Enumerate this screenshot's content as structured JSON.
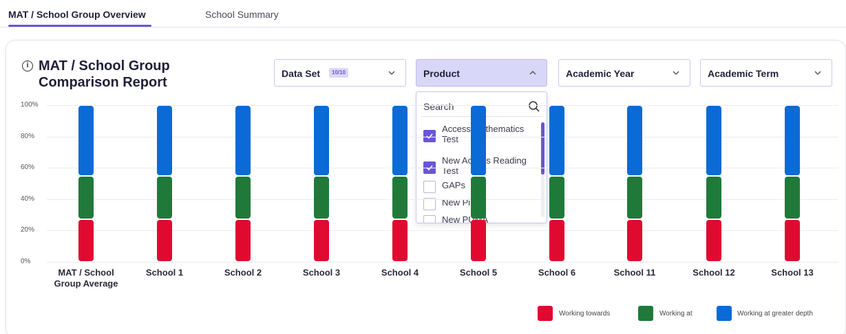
{
  "tabs": [
    {
      "label": "MAT / School Group Overview",
      "active": true
    },
    {
      "label": "School Summary",
      "active": false
    }
  ],
  "report": {
    "info_icon": "info-circle-icon",
    "title": "MAT / School Group Comparison Report"
  },
  "filters": {
    "dataset": {
      "label": "Data Set",
      "badge": "10/10"
    },
    "product": {
      "label": "Product"
    },
    "year": {
      "label": "Academic Year"
    },
    "term": {
      "label": "Academic Term"
    }
  },
  "product_panel": {
    "search_placeholder": "Search",
    "options": [
      {
        "label": "Access Mathematics Test",
        "checked": true
      },
      {
        "label": "New Access Reading Test",
        "checked": true
      },
      {
        "label": "GAPs",
        "checked": false
      },
      {
        "label": "New PiRA",
        "checked": false
      },
      {
        "label": "New PUMA",
        "checked": false
      }
    ]
  },
  "colors": {
    "accent": "#6a55d6",
    "working_towards": "#e0092f",
    "working_at": "#1f7a3a",
    "greater_depth": "#0a6ad6"
  },
  "chart_data": {
    "type": "bar",
    "stacked": true,
    "categories": [
      "MAT / School Group Average",
      "School 1",
      "School 2",
      "School 3",
      "School 4",
      "School 5",
      "School 6",
      "School 11",
      "School 12",
      "School 13"
    ],
    "series": [
      {
        "name": "Working towards",
        "values": [
          27,
          27,
          27,
          27,
          27,
          27,
          27,
          27,
          27,
          27
        ]
      },
      {
        "name": "Working at",
        "values": [
          28,
          28,
          28,
          28,
          28,
          28,
          28,
          28,
          28,
          28
        ]
      },
      {
        "name": "Working at greater depth",
        "values": [
          45,
          45,
          45,
          45,
          45,
          45,
          45,
          45,
          45,
          45
        ]
      }
    ],
    "yticks": [
      "100%",
      "80%",
      "60%",
      "40%",
      "20%",
      "0%"
    ],
    "ylim": [
      0,
      100
    ],
    "legend_position": "bottom-right",
    "grid": true
  }
}
